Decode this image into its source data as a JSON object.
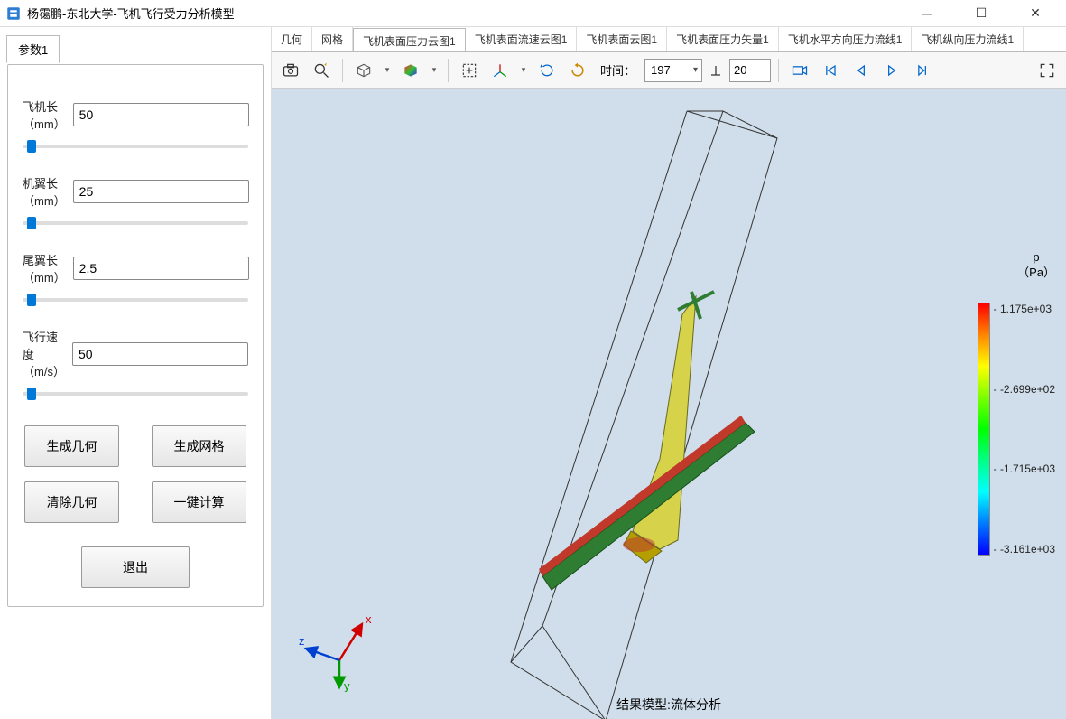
{
  "window": {
    "title": "杨霭鹏-东北大学-飞机飞行受力分析模型"
  },
  "sidebar": {
    "tab_label": "参数1",
    "fields": {
      "plane_length": {
        "label": "飞机长（mm）",
        "value": "50"
      },
      "wing_length": {
        "label": "机翼长（mm）",
        "value": "25"
      },
      "tail_length": {
        "label": "尾翼长（mm）",
        "value": "2.5"
      },
      "flight_speed": {
        "label": "飞行速度（m/s）",
        "value": "50"
      }
    },
    "buttons": {
      "gen_geom": "生成几何",
      "gen_mesh": "生成网格",
      "clear_geom": "清除几何",
      "compute": "一键计算",
      "exit": "退出"
    }
  },
  "tabs": [
    "几何",
    "网格",
    "飞机表面压力云图1",
    "飞机表面流速云图1",
    "飞机表面云图1",
    "飞机表面压力矢量1",
    "飞机水平方向压力流线1",
    "飞机纵向压力流线1"
  ],
  "active_tab_index": 2,
  "toolbar": {
    "time_label": "时间：",
    "time_value": "197",
    "frame_value": "20"
  },
  "viewport": {
    "result_label": "结果模型:流体分析",
    "triad": {
      "x": "x",
      "y": "y",
      "z": "z"
    }
  },
  "colorbar": {
    "title_line1": "p",
    "title_line2": "（Pa）",
    "ticks": [
      "1.175e+03",
      "-2.699e+02",
      "-1.715e+03",
      "-3.161e+03"
    ]
  }
}
